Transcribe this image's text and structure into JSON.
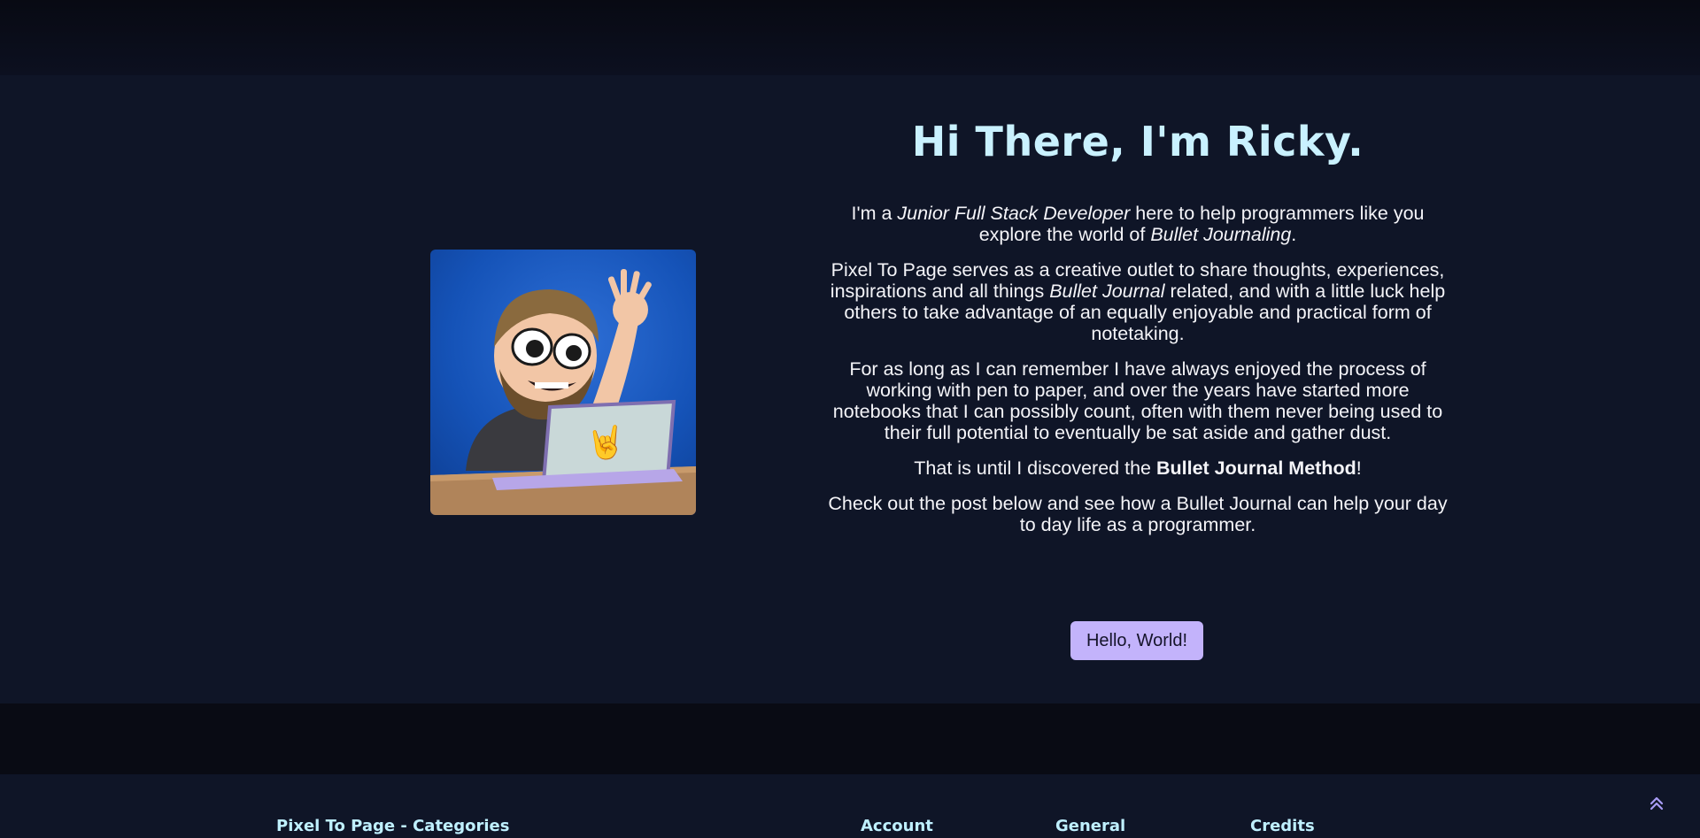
{
  "hero": {
    "title": "Hi There, I'm Ricky.",
    "p1": {
      "a": "I'm a ",
      "b": "Junior Full Stack Developer",
      "c": " here to help programmers like you explore the world of ",
      "d": "Bullet Journaling",
      "e": "."
    },
    "p2": {
      "a": "Pixel To Page serves as a creative outlet to share thoughts, experiences, inspirations and all things ",
      "b": "Bullet Journal",
      "c": " related, and with a little luck help others to take advantage of an equally enjoyable and practical form of notetaking."
    },
    "p3": "For as long as I can remember I have always enjoyed the process of working with pen to paper, and over the years have started more notebooks that I can possibly count, often with them never being used to their full potential to eventually be sat aside and gather dust.",
    "p4": {
      "a": "That is until I discovered the ",
      "b": "Bullet Journal Method",
      "c": "!"
    },
    "p5": "Check out the post below and see how a Bullet Journal can help your day to day life as a programmer.",
    "button_label": "Hello, World!",
    "avatar_icon": "waving-developer-avatar"
  },
  "footer": {
    "headings": [
      "Pixel To Page - Categories",
      "Account",
      "General",
      "Credits"
    ],
    "scroll_icon": "double-chevron-up-icon"
  },
  "colors": {
    "background": "#0f1527",
    "title": "#c9f1ff",
    "button": "#c3b3fb",
    "footer_heading": "#bff0ff"
  }
}
